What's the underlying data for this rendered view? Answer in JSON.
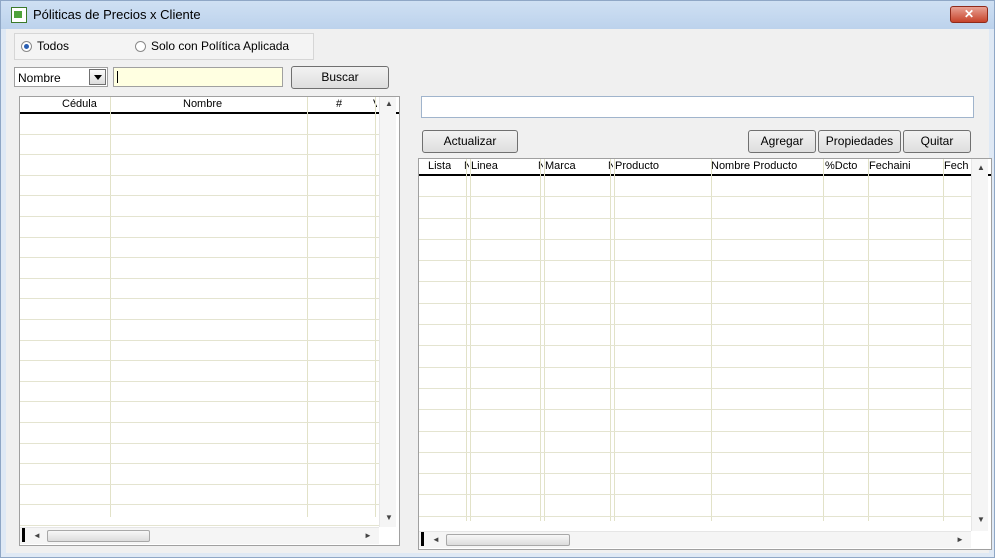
{
  "window": {
    "title": "Póliticas de Precios x Cliente",
    "close_label": "✕"
  },
  "filter": {
    "options": [
      {
        "label": "Todos",
        "selected": true
      },
      {
        "label": "Solo con Política Aplicada",
        "selected": false
      }
    ]
  },
  "search": {
    "field_value": "Nombre",
    "input_value": "",
    "button_label": "Buscar"
  },
  "clients_grid": {
    "columns": [
      "Cédula",
      "Nombre",
      "#",
      "V"
    ]
  },
  "detail": {
    "filter_value": "",
    "refresh_label": "Actualizar",
    "add_label": "Agregar",
    "properties_label": "Propiedades",
    "remove_label": "Quitar",
    "columns": [
      "Lista",
      "N",
      "Linea",
      "N",
      "Marca",
      "N",
      "Producto",
      "Nombre Producto",
      "%Dcto",
      "Fechaini",
      "Fech"
    ]
  }
}
